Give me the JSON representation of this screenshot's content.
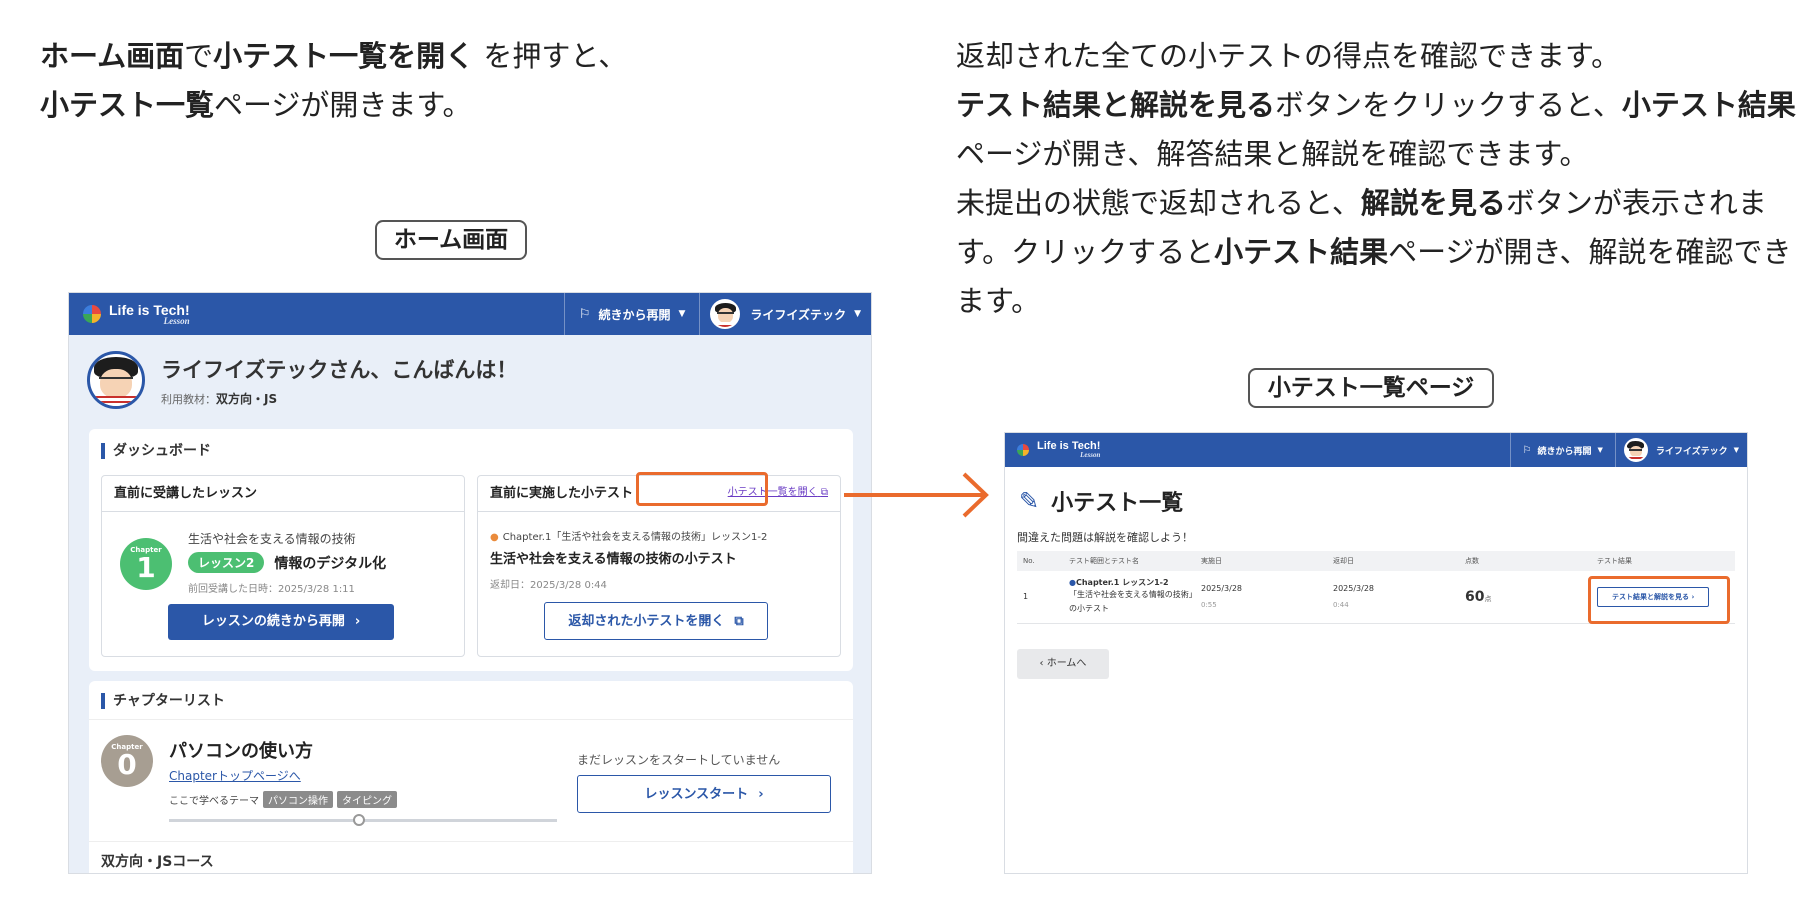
{
  "left_text": {
    "part1_bold": "ホーム画面",
    "part2": "で",
    "part3_bold": "小テスト一覧を開く",
    "part4": " を押すと、",
    "part5_bold": "小テスト一覧",
    "part6": "ページが開きます。"
  },
  "right_text": {
    "line1": "返却された全ての小テストの得点を確認できます。",
    "p2_bold": "テスト結果と解説を見る",
    "p2_text": "ボタンをクリックすると、",
    "p2_bold2": "小テスト結果",
    "p2_text2": "ページが開き、解答結果と解説を確認できます。",
    "p3_text": "未提出の状態で返却されると、",
    "p3_bold": "解説を見る",
    "p3_text2": "ボタンが表示されます。クリックすると",
    "p3_bold2": "小テスト結果",
    "p3_text3": "ページが開き、解説を確認できます。"
  },
  "captions": {
    "home": "ホーム画面",
    "quiz_list": "小テスト一覧ページ"
  },
  "home_screen": {
    "logo": "Life is Tech!",
    "logo_sub": "Lesson",
    "resume_label": "続きから再開",
    "user_name": "ライフイズテック",
    "greeting": "ライフイズテックさん、こんばんは！",
    "material_label": "利用教材：",
    "material_value": "双方向・JS",
    "dashboard_title": "ダッシュボード",
    "last_lesson_title": "直前に受講したレッスン",
    "chapter_small": "Chapter",
    "lesson_chapter_num": "1",
    "lesson_course": "生活や社会を支える情報の技術",
    "lesson_pill": "レッスン2",
    "lesson_name": "情報のデジタル化",
    "lesson_date": "前回受講した日時：2025/3/28 1:11",
    "resume_lesson_btn": "レッスンの続きから再開",
    "last_quiz_title": "直前に実施した小テスト",
    "quiz_list_link": "小テスト一覧を開く",
    "quiz_chapter": "Chapter.1「生活や社会を支える情報の技術」レッスン1-2",
    "quiz_title": "生活や社会を支える情報の技術の小テスト",
    "quiz_return": "返却日：2025/3/28 0:44",
    "open_returned_btn": "返却された小テストを開く",
    "chapter_list_title": "チャプターリスト",
    "chap0_num": "0",
    "chap0_title": "パソコンの使い方",
    "chap0_link": "Chapterトップページへ",
    "chap0_theme_label": "ここで学べるテーマ",
    "chap0_tags": [
      "パソコン操作",
      "タイピング"
    ],
    "chap0_status": "まだレッスンをスタートしていません",
    "start_btn": "レッスンスタート",
    "course_label": "双方向・JSコース"
  },
  "quiz_screen": {
    "logo": "Life is Tech!",
    "logo_sub": "Lesson",
    "resume_label": "続きから再開",
    "user_name": "ライフイズテック",
    "page_title": "小テスト一覧",
    "page_sub": "間違えた問題は解説を確認しよう！",
    "columns": [
      "No.",
      "テスト範囲とテスト名",
      "実施日",
      "返却日",
      "点数",
      "テスト結果"
    ],
    "rows": [
      {
        "no": "1",
        "chapter": "Chapter.1 レッスン1-2",
        "name": "「生活や社会を支える情報の技術」の小テスト",
        "done_date": "2025/3/28",
        "done_time": "0:55",
        "return_date": "2025/3/28",
        "return_time": "0:44",
        "score": "60",
        "score_unit": "点",
        "result_btn": "テスト結果と解説を見る"
      }
    ],
    "home_btn": "ホームへ"
  },
  "colors": {
    "brand_blue": "#2b57a8",
    "highlight_orange": "#ea6b2d",
    "lesson_green": "#4cbf72"
  }
}
